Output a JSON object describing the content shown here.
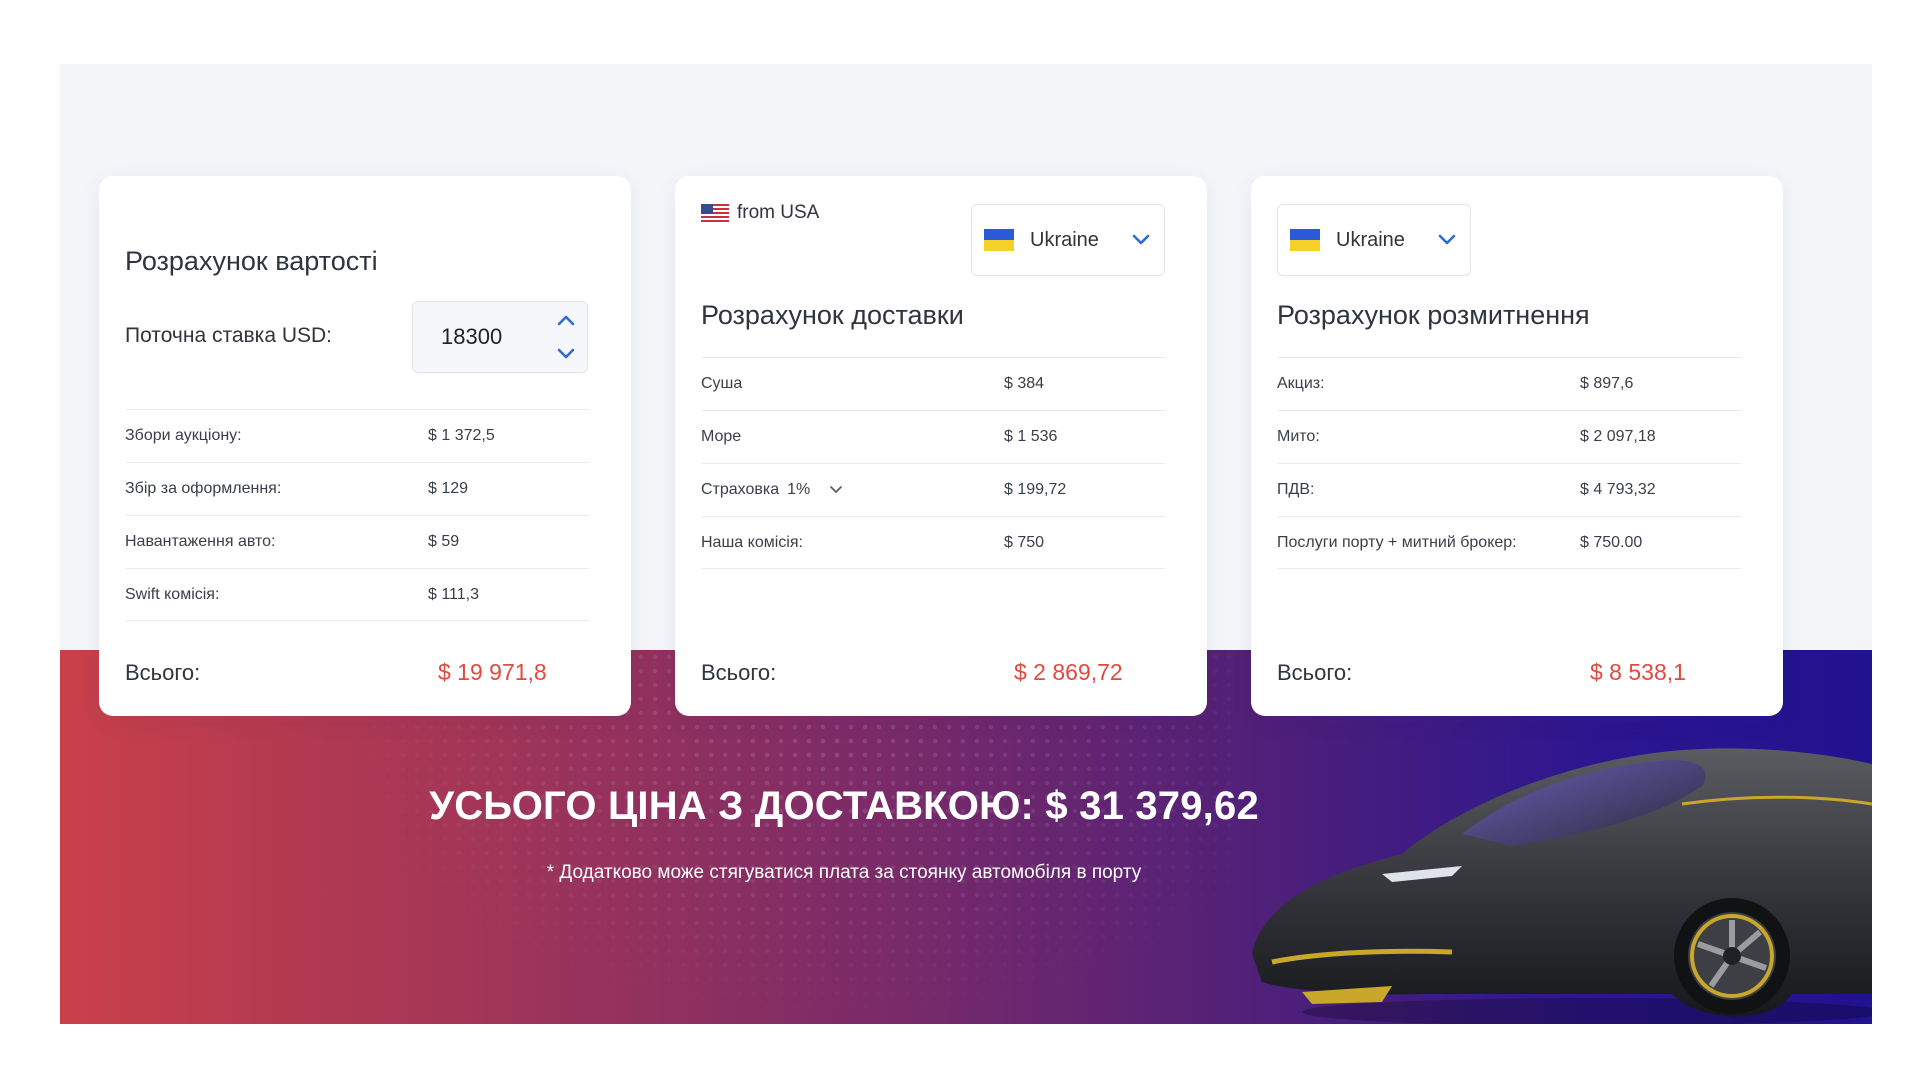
{
  "colors": {
    "accent_red": "#e0493e",
    "chevron_blue": "#2f6bd6",
    "banner_gradient": [
      "#c9404a",
      "#7b2b68",
      "#21128f"
    ]
  },
  "cost_card": {
    "title": "Розрахунок вартості",
    "rate_label": "Поточна ставка USD:",
    "rate_value": "18300",
    "rows": [
      {
        "label": "Збори аукціону:",
        "value": "$ 1 372,5"
      },
      {
        "label": "Збір за оформлення:",
        "value": "$ 129"
      },
      {
        "label": "Навантаження авто:",
        "value": "$ 59"
      },
      {
        "label": "Swift комісія:",
        "value": "$ 111,3"
      }
    ],
    "total_label": "Всього:",
    "total_value": "$ 19 971,8"
  },
  "delivery_card": {
    "origin": "from USA",
    "destination": "Ukraine",
    "title": "Розрахунок доставки",
    "rows": [
      {
        "label": "Суша",
        "value": "$ 384"
      },
      {
        "label": "Море",
        "value": "$ 1 536"
      },
      {
        "label": "Страховка",
        "option": "1%",
        "value": "$ 199,72"
      },
      {
        "label": "Наша комісія:",
        "value": "$ 750"
      }
    ],
    "total_label": "Всього:",
    "total_value": "$ 2 869,72"
  },
  "customs_card": {
    "destination": "Ukraine",
    "title": "Розрахунок розмитнення",
    "rows": [
      {
        "label": "Акциз:",
        "value": "$ 897,6"
      },
      {
        "label": "Мито:",
        "value": "$ 2 097,18"
      },
      {
        "label": "ПДВ:",
        "value": "$ 4 793,32"
      },
      {
        "label": "Послуги порту + митний брокер:",
        "value": "$ 750.00"
      }
    ],
    "total_label": "Всього:",
    "total_value": "$ 8 538,1"
  },
  "summary": {
    "total_text": "УСЬОГО ЦІНА З ДОСТАВКОЮ: $ 31 379,62",
    "note": "* Додатково може стягуватися плата за стоянку автомобіля в порту"
  },
  "icons": {
    "us_flag": "us-flag-icon",
    "ua_flag": "ukraine-flag-icon",
    "chevron": "chevron-down-icon",
    "stepper_up": "chevron-up-icon"
  }
}
